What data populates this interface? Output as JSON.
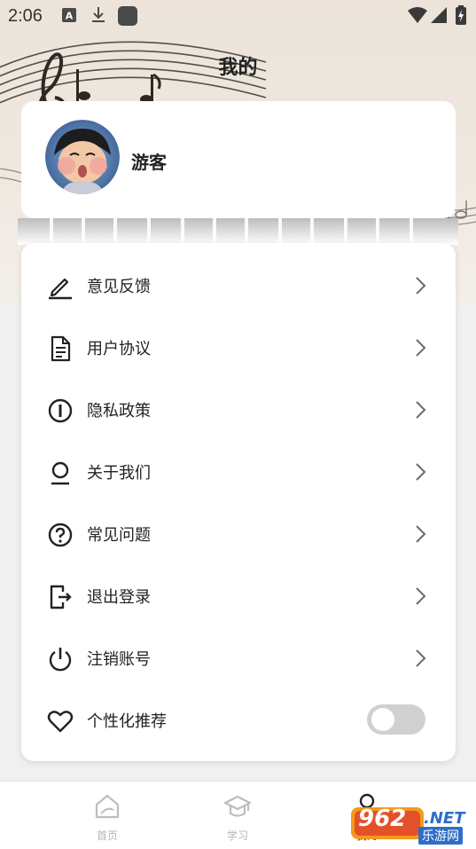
{
  "status_bar": {
    "time": "2:06",
    "left_icons": [
      "a-keyboard-icon",
      "download-icon",
      "app-square-icon"
    ],
    "right_icons": [
      "wifi-icon",
      "signal-icon",
      "battery-charging-icon"
    ]
  },
  "header": {
    "title": "我的"
  },
  "profile": {
    "username": "游客"
  },
  "menu": {
    "items": [
      {
        "label": "意见反馈",
        "icon": "pen-icon"
      },
      {
        "label": "用户协议",
        "icon": "document-icon"
      },
      {
        "label": "隐私政策",
        "icon": "info-circle-icon"
      },
      {
        "label": "关于我们",
        "icon": "user-icon"
      },
      {
        "label": "常见问题",
        "icon": "question-circle-icon"
      },
      {
        "label": "退出登录",
        "icon": "logout-icon"
      },
      {
        "label": "注销账号",
        "icon": "power-icon"
      }
    ],
    "toggle_item": {
      "label": "个性化推荐",
      "icon": "heart-icon",
      "enabled": false
    }
  },
  "tabbar": {
    "tabs": [
      {
        "label": "首页",
        "icon": "home-icon"
      },
      {
        "label": "学习",
        "icon": "graduation-cap-icon"
      },
      {
        "label": "我的",
        "icon": "user-icon"
      }
    ]
  },
  "watermark": {
    "number": "962",
    "suffix": ".NET",
    "text": "乐游网"
  },
  "colors": {
    "background": "#f0f0f0",
    "card": "#ffffff",
    "text_primary": "#222222",
    "tab_inactive": "#b5b5b5",
    "toggle_off": "#d0d0d0",
    "watermark_blue": "#2f6ec6"
  }
}
